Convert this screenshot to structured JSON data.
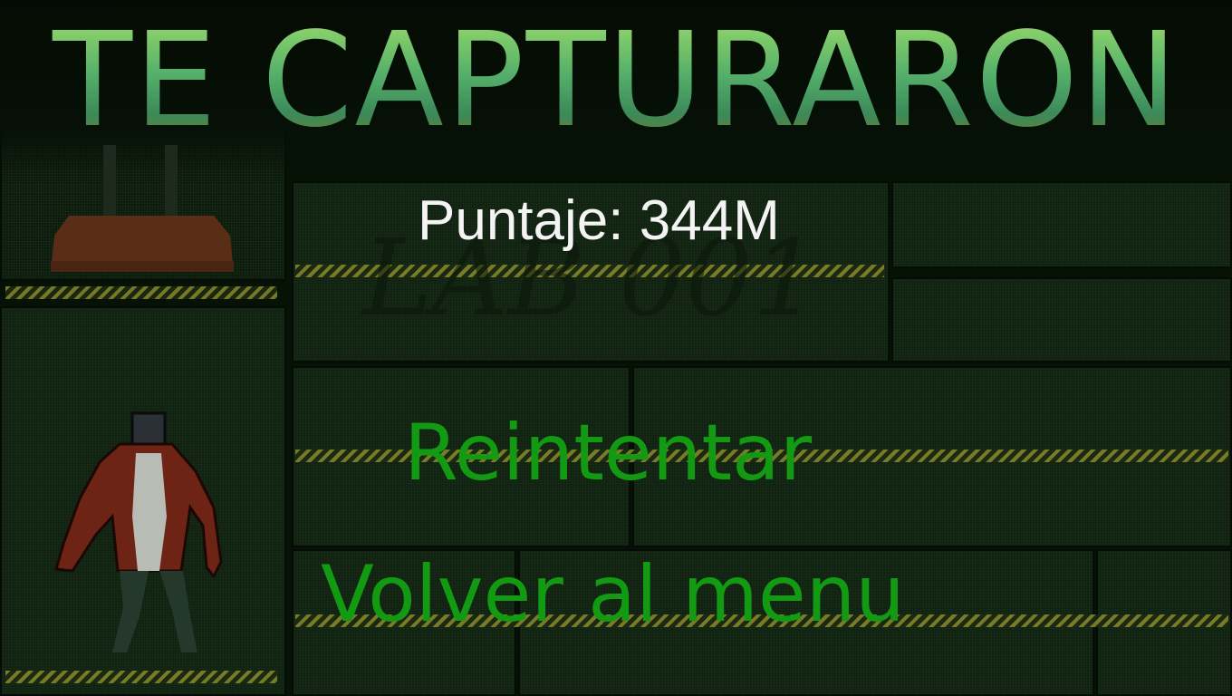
{
  "screen": {
    "title": "TE CAPTURARON",
    "score_text": "Puntaje: 344M",
    "lab_sign": "LAB 001"
  },
  "menu": {
    "retry_label": "Reintentar",
    "back_label": "Volver al menu"
  },
  "colors": {
    "background": "#071207",
    "title_green": "#5fa860",
    "menu_green": "#129a12",
    "score_white": "#f4f4f4",
    "hazard_yellow": "#8a8a2a"
  },
  "icons": {
    "player": "lab-creature-sprite",
    "lamp": "ceiling-lamp-sprite"
  }
}
